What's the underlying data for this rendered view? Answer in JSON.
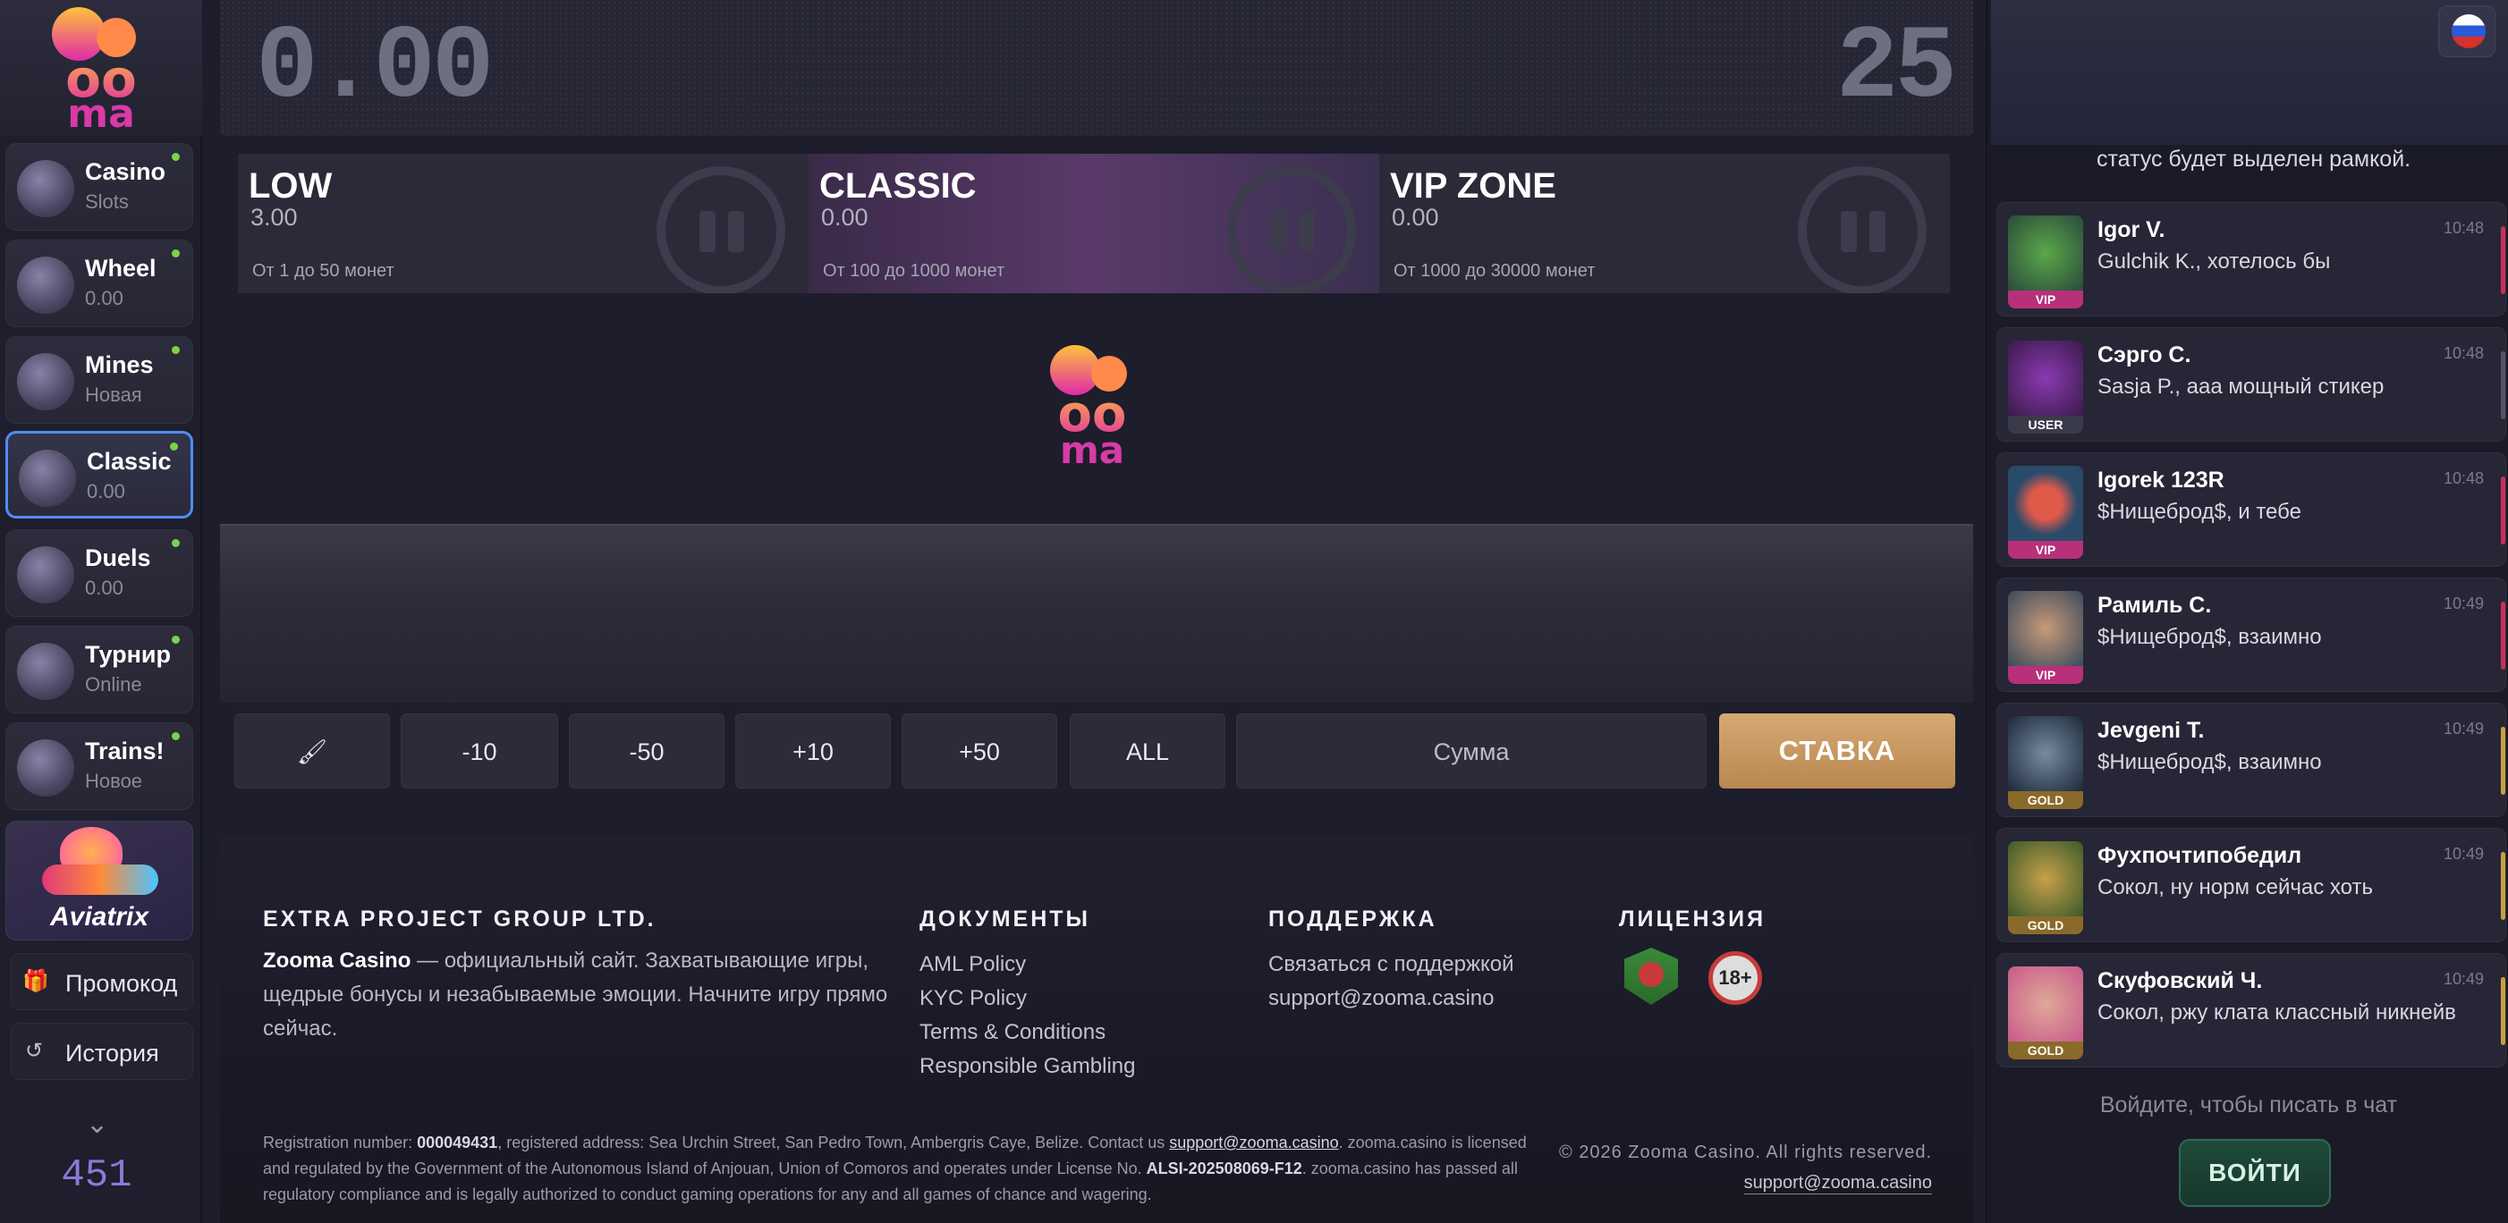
{
  "sidebar": {
    "nav": [
      {
        "label": "Casino",
        "sub": "Slots"
      },
      {
        "label": "Wheel",
        "sub": "0.00"
      },
      {
        "label": "Mines",
        "sub": "Новая"
      },
      {
        "label": "Classic",
        "sub": "0.00"
      },
      {
        "label": "Duels",
        "sub": "0.00"
      },
      {
        "label": "Турнир",
        "sub": "Online"
      },
      {
        "label": "Trains!",
        "sub": "Новое"
      }
    ],
    "promo_game": "Aviatrix",
    "promo_label": "Промокод",
    "history_label": "История",
    "online_count": "451"
  },
  "game": {
    "balance": "0.00",
    "timer": "25",
    "rooms": [
      {
        "name": "LOW",
        "value": "3.00",
        "range": "От 1 до 50 монет"
      },
      {
        "name": "CLASSIC",
        "value": "0.00",
        "range": "От 100 до 1000 монет"
      },
      {
        "name": "VIP ZONE",
        "value": "0.00",
        "range": "От 1000 до 30000 монет"
      }
    ],
    "controls": {
      "clear_icon": "broom-icon",
      "minus10": "-10",
      "minus50": "-50",
      "plus10": "+10",
      "plus50": "+50",
      "all": "ALL",
      "amount_placeholder": "Сумма",
      "bet": "СТАВКА"
    }
  },
  "footer": {
    "company": "EXTRA PROJECT GROUP LTD.",
    "brand": "Zooma Casino",
    "about": " — официальный сайт. Захватывающие игры, щедрые бонусы и незабываемые эмоции. Начните игру прямо сейчас.",
    "docs_title": "ДОКУМЕНТЫ",
    "docs": [
      "AML Policy",
      "KYC Policy",
      "Terms & Conditions",
      "Responsible Gambling"
    ],
    "support_title": "ПОДДЕРЖКА",
    "support_contact": "Связаться с поддержкой",
    "support_email": "support@zooma.casino",
    "license_title": "ЛИЦЕНЗИЯ",
    "age_badge": "18+",
    "reg_prefix": "Registration number: ",
    "reg_number": "000049431",
    "reg_mid": ", registered address: Sea Urchin Street, San Pedro Town, Ambergris Caye, Belize. Contact us ",
    "reg_email": "support@zooma.casino",
    "reg_mid2": ". zooma.casino is licensed and regulated by the Government of the Autonomous Island of Anjouan, Union of Comoros and operates under License No. ",
    "license_no": "ALSI-202508069-F12",
    "reg_end": ". zooma.casino has passed all regulatory compliance and is legally authorized to conduct gaming operations for any and all games of chance and wagering.",
    "copyright": "© 2026 Zooma Casino. All rights reserved.",
    "footer_email": "support@zooma.casino"
  },
  "chat": {
    "top_partial": "статус будет выделен рамкой.",
    "messages": [
      {
        "user": "Igor V.",
        "text": "Gulchik K., хотелось бы",
        "time": "10:48",
        "badge": "VIP",
        "badge_color": "#b8307a",
        "accent": "#c8305a"
      },
      {
        "user": "Сэрго С.",
        "text": "Sasja P., ааа мощный стикер",
        "time": "10:48",
        "badge": "USER",
        "badge_color": "#3a3a4a",
        "accent": "#555566"
      },
      {
        "user": "Igorek 123R",
        "text": "$Нищеброд$, и тебе",
        "time": "10:48",
        "badge": "VIP",
        "badge_color": "#b8307a",
        "accent": "#c8305a"
      },
      {
        "user": "Рамиль С.",
        "text": "$Нищеброд$, взаимно",
        "time": "10:49",
        "badge": "VIP",
        "badge_color": "#b8307a",
        "accent": "#c8305a"
      },
      {
        "user": "Jevgeni T.",
        "text": "$Нищеброд$, взаимно",
        "time": "10:49",
        "badge": "GOLD",
        "badge_color": "#8a6a2a",
        "accent": "#c8a040"
      },
      {
        "user": "Фухпочтипобедил",
        "text": "Сокол, ну норм сейчас хоть",
        "time": "10:49",
        "badge": "GOLD",
        "badge_color": "#8a6a2a",
        "accent": "#c8a040"
      },
      {
        "user": "Скуфовский Ч.",
        "text": "Сокол, ржу клата классный никнейв",
        "time": "10:49",
        "badge": "GOLD",
        "badge_color": "#8a6a2a",
        "accent": "#c8a040"
      }
    ],
    "login_hint": "Войдите, чтобы писать в чат",
    "login_button": "ВОЙТИ"
  }
}
